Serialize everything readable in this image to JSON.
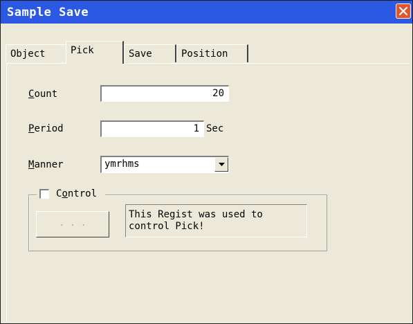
{
  "window": {
    "title": "Sample Save"
  },
  "tabs": [
    {
      "label": "Object"
    },
    {
      "label": "Pick",
      "active": true
    },
    {
      "label": "Save"
    },
    {
      "label": "Position"
    }
  ],
  "form": {
    "count_label": "Count",
    "count_value": "20",
    "period_label": "Period",
    "period_value": "1",
    "period_unit": "Sec",
    "manner_label": "Manner",
    "manner_value": "ymrhms"
  },
  "control_group": {
    "label": "Control",
    "checked": false,
    "button_label": ". . .",
    "info_text": "This Regist was used to\ncontrol Pick!"
  },
  "colors": {
    "titlebar": "#2b59e3",
    "close_button": "#e1552e",
    "dialog_bg": "#ece9d8"
  }
}
